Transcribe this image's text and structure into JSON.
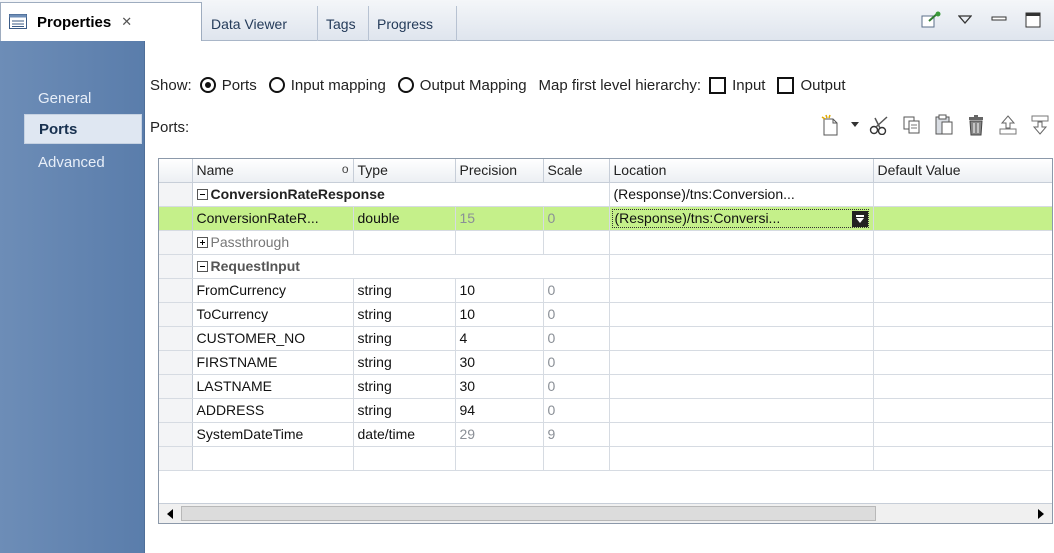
{
  "tabs": [
    {
      "label": "Properties",
      "active": true,
      "icon": "properties-icon"
    },
    {
      "label": "Data Viewer"
    },
    {
      "label": "Tags"
    },
    {
      "label": "Progress"
    }
  ],
  "sidenav": {
    "items": [
      {
        "label": "General"
      },
      {
        "label": "Ports",
        "active": true
      },
      {
        "label": "Advanced"
      }
    ]
  },
  "show_bar": {
    "show_label": "Show:",
    "options": [
      {
        "label": "Ports",
        "selected": true
      },
      {
        "label": "Input mapping",
        "selected": false
      },
      {
        "label": "Output Mapping",
        "selected": false
      }
    ],
    "hierarchy_label": "Map first level hierarchy:",
    "checkboxes": [
      {
        "label": "Input",
        "checked": false
      },
      {
        "label": "Output",
        "checked": false
      }
    ]
  },
  "ports_label": "Ports:",
  "toolbar_icons": [
    "new-port-icon",
    "dropdown-arrow-icon",
    "cut-icon",
    "copy-icon",
    "paste-icon",
    "delete-icon",
    "move-up-icon",
    "move-down-icon"
  ],
  "grid": {
    "columns": [
      "Name",
      "Type",
      "Precision",
      "Scale",
      "Location",
      "Default Value"
    ],
    "sort_marker": "o",
    "rows": [
      {
        "kind": "group",
        "name": "ConversionRateResponse",
        "type": "",
        "precision": "",
        "scale": "",
        "location": "(Response)/tns:Conversion...",
        "default": ""
      },
      {
        "kind": "selected",
        "name": "ConversionRateR...",
        "type": "double",
        "precision": "15",
        "scale": "0",
        "location": "(Response)/tns:Conversi...",
        "default": ""
      },
      {
        "kind": "passthrough",
        "name": "Passthrough",
        "type": "",
        "precision": "",
        "scale": "",
        "location": "",
        "default": ""
      },
      {
        "kind": "group",
        "name": "RequestInput",
        "type": "",
        "precision": "",
        "scale": "",
        "location": "",
        "default": ""
      },
      {
        "kind": "port",
        "name": "FromCurrency",
        "type": "string",
        "precision": "10",
        "scale": "0",
        "location": "",
        "default": ""
      },
      {
        "kind": "port",
        "name": "ToCurrency",
        "type": "string",
        "precision": "10",
        "scale": "0",
        "location": "",
        "default": ""
      },
      {
        "kind": "port",
        "name": "CUSTOMER_NO",
        "type": "string",
        "precision": "4",
        "scale": "0",
        "location": "",
        "default": ""
      },
      {
        "kind": "port",
        "name": "FIRSTNAME",
        "type": "string",
        "precision": "30",
        "scale": "0",
        "location": "",
        "default": ""
      },
      {
        "kind": "port",
        "name": "LASTNAME",
        "type": "string",
        "precision": "30",
        "scale": "0",
        "location": "",
        "default": ""
      },
      {
        "kind": "port",
        "name": "ADDRESS",
        "type": "string",
        "precision": "94",
        "scale": "0",
        "location": "",
        "default": ""
      },
      {
        "kind": "port",
        "name": "SystemDateTime",
        "type": "date/time",
        "precision": "29",
        "scale": "9",
        "location": "",
        "default": ""
      },
      {
        "kind": "empty",
        "name": "",
        "type": "",
        "precision": "",
        "scale": "",
        "location": "",
        "default": ""
      }
    ]
  },
  "colors": {
    "selected_row": "#c5f08a",
    "sidenav": "#5a7dab",
    "active_tab_bg": "#ffffff"
  }
}
